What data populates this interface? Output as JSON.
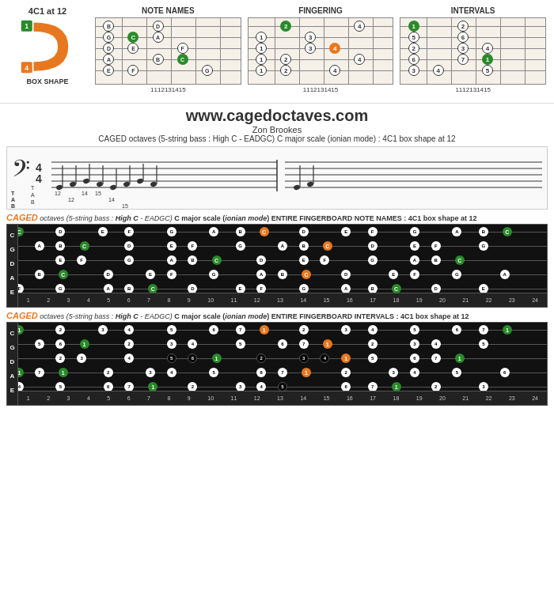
{
  "header": {
    "box_shape_title": "4C1 at 12",
    "box_shape_label": "BOX SHAPE",
    "diagrams": [
      {
        "title": "NOTE NAMES",
        "fret_numbers": [
          "11",
          "12",
          "13",
          "14",
          "15"
        ]
      },
      {
        "title": "FINGERING",
        "fret_numbers": [
          "11",
          "12",
          "13",
          "14",
          "15"
        ]
      },
      {
        "title": "INTERVALS",
        "fret_numbers": [
          "11",
          "12",
          "13",
          "14",
          "15"
        ]
      }
    ]
  },
  "website": {
    "url": "www.cagedoctaves.com",
    "author": "Zon Brookes",
    "description": "CAGED octaves (5-string bass : High C - EADGC) C major scale (ionian mode) : 4C1 box shape at 12"
  },
  "caged_label": "CAGED",
  "fb1_title_prefix": "CAGED octaves (5-string bass : ",
  "fb1_title_high_c": "High C",
  "fb1_title_suffix": " - EADGC) C major scale (ionian mode) ENTIRE FINGERBOARD NOTE NAMES : 4C1 box shape at 12",
  "fb2_title_prefix": "CAGED octaves (5-string bass : ",
  "fb2_title_high_c": "High C",
  "fb2_title_suffix": " - EADGC) C major scale (ionian mode) ENTIRE FINGERBOARD INTERVALS : 4C1 box shape at 12",
  "fb1_fret_numbers": [
    "1",
    "2",
    "3",
    "4",
    "5",
    "6",
    "7",
    "8",
    "9",
    "10",
    "11",
    "12",
    "13",
    "14",
    "15",
    "16",
    "17",
    "18",
    "19",
    "20",
    "21",
    "22",
    "23",
    "24"
  ],
  "fb2_fret_numbers": [
    "1",
    "2",
    "3",
    "4",
    "5",
    "6",
    "7",
    "8",
    "9",
    "10",
    "11",
    "12",
    "13",
    "14",
    "15",
    "16",
    "17",
    "18",
    "19",
    "20",
    "21",
    "22",
    "23",
    "24"
  ],
  "colors": {
    "green": "#2a8a2a",
    "orange": "#e87820",
    "white": "#ffffff",
    "black": "#000000"
  }
}
